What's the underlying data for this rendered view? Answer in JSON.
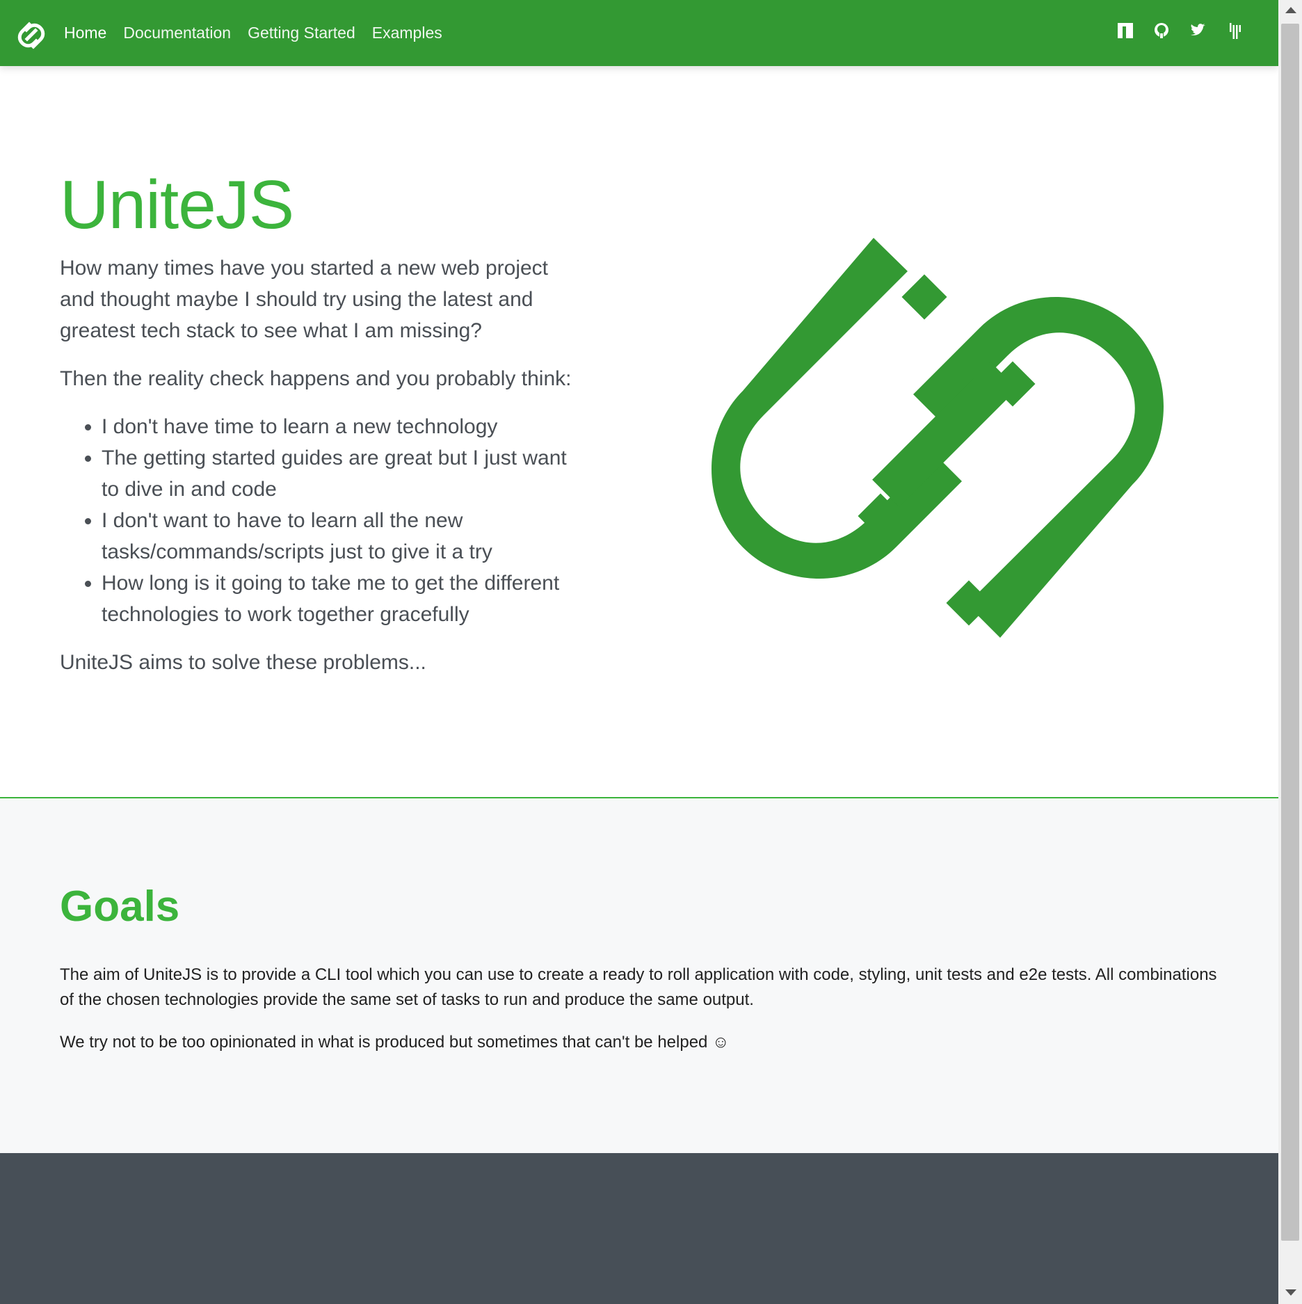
{
  "nav": {
    "links": [
      {
        "label": "Home",
        "active": true
      },
      {
        "label": "Documentation",
        "active": false
      },
      {
        "label": "Getting Started",
        "active": false
      },
      {
        "label": "Examples",
        "active": false
      }
    ],
    "icons": [
      "npm-icon",
      "github-icon",
      "twitter-icon",
      "gitter-icon"
    ]
  },
  "hero": {
    "title": "UniteJS",
    "intro": "How many times have you started a new web project and thought maybe I should try using the latest and greatest tech stack to see what I am missing?",
    "reality": "Then the reality check happens and you probably think:",
    "problems": [
      "I don't have time to learn a new technology",
      "The getting started guides are great but I just want to dive in and code",
      "I don't want to have to learn all the new tasks/commands/scripts just to give it a try",
      "How long is it going to take me to get the different technologies to work together gracefully"
    ],
    "conclusion": "UniteJS aims to solve these problems..."
  },
  "goals": {
    "title": "Goals",
    "paragraph1": "The aim of UniteJS is to provide a CLI tool which you can use to create a ready to roll application with code, styling, unit tests and e2e tests. All combinations of the chosen technologies provide the same set of tasks to run and produce the same output.",
    "paragraph2": "We try not to be too opinionated in what is produced but sometimes that can't be helped ☺"
  },
  "colors": {
    "nav_bg": "#339933",
    "brand_green": "#3cb43c",
    "goals_bg": "#f7f8f9",
    "footer_bg": "#474f57"
  }
}
